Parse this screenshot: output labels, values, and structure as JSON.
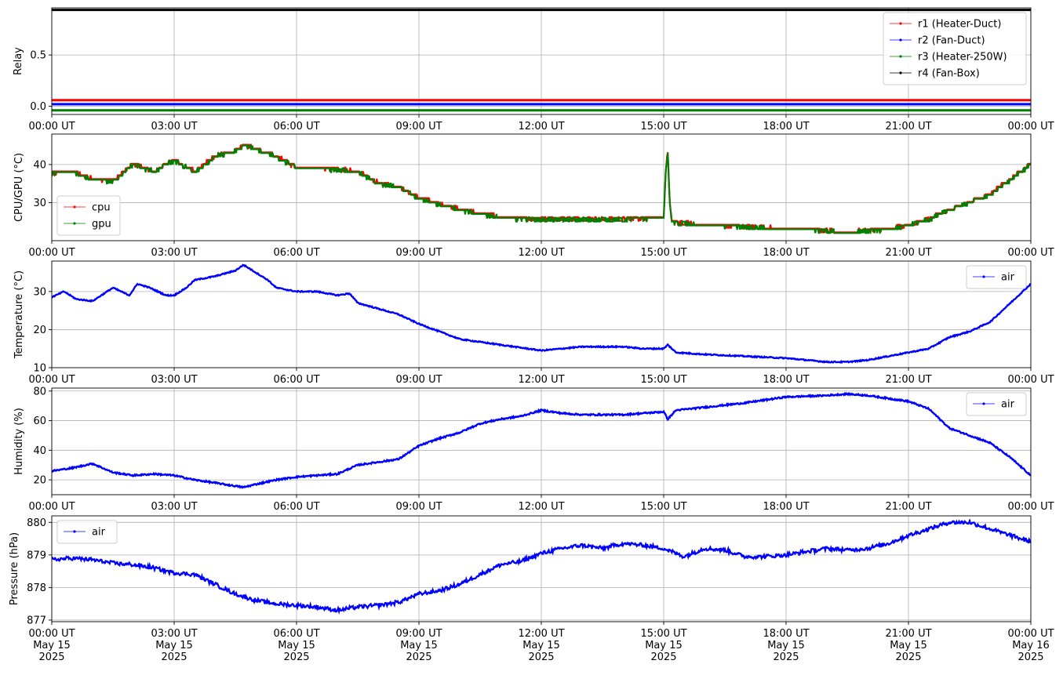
{
  "chart_data": [
    {
      "type": "line",
      "ylabel": "Relay",
      "ylim": [
        -0.08,
        0.96
      ],
      "yticks": [
        0.0,
        0.5
      ],
      "ytick_labels": [
        "0.0",
        "0.5"
      ],
      "grid": true,
      "legend": "top-right",
      "x_tick_labels": [
        "00:00 UT",
        "03:00 UT",
        "06:00 UT",
        "09:00 UT",
        "12:00 UT",
        "15:00 UT",
        "18:00 UT",
        "21:00 UT",
        "00:00 UT"
      ],
      "series": [
        {
          "name": "r1 (Heater-Duct)",
          "color": "#ff0000",
          "style": "constant",
          "value": 0.06
        },
        {
          "name": "r2 (Fan-Duct)",
          "color": "#0000ff",
          "style": "constant",
          "value": 0.02
        },
        {
          "name": "r3 (Heater-250W)",
          "color": "#008000",
          "style": "constant",
          "value": -0.04
        },
        {
          "name": "r4 (Fan-Box)",
          "color": "#000000",
          "style": "constant",
          "value": 0.94
        }
      ]
    },
    {
      "type": "scatter",
      "ylabel": "CPU/GPU (°C)",
      "ylim": [
        20,
        48
      ],
      "yticks": [
        30,
        40
      ],
      "ytick_labels": [
        "30",
        "40"
      ],
      "grid": true,
      "legend": "center-left",
      "x_tick_labels": [
        "00:00 UT",
        "03:00 UT",
        "06:00 UT",
        "09:00 UT",
        "12:00 UT",
        "15:00 UT",
        "18:00 UT",
        "21:00 UT",
        "00:00 UT"
      ],
      "series": [
        {
          "name": "cpu",
          "color": "#ff0000"
        },
        {
          "name": "gpu",
          "color": "#008000"
        }
      ],
      "x_hours": [
        0,
        0.5,
        1.0,
        1.5,
        2.0,
        2.5,
        3.0,
        3.5,
        4.0,
        4.5,
        4.7,
        5.0,
        5.5,
        6.0,
        6.5,
        7.0,
        7.5,
        8.0,
        8.5,
        9.0,
        9.5,
        10.0,
        10.5,
        11.0,
        12.0,
        13.0,
        14.0,
        15.0,
        15.05,
        15.1,
        15.15,
        15.2,
        15.3,
        16.0,
        17.0,
        18.0,
        18.5,
        19.0,
        19.5,
        20.0,
        20.5,
        21.0,
        21.5,
        22.0,
        22.5,
        23.0,
        23.5,
        24.0
      ],
      "y_values": [
        37.5,
        38,
        36,
        35.5,
        40,
        38,
        41,
        38,
        42,
        43.5,
        45,
        44,
        42,
        39,
        39,
        38.5,
        38,
        35,
        34,
        31,
        29.5,
        28,
        27,
        26,
        25.5,
        25.5,
        25.5,
        26,
        38,
        43,
        30,
        25,
        24.5,
        24,
        23.5,
        23,
        23,
        22.5,
        22,
        22.5,
        23,
        24,
        25.5,
        28,
        30,
        32,
        36,
        40
      ]
    },
    {
      "type": "scatter",
      "ylabel": "Temperature (°C)",
      "ylim": [
        10,
        38
      ],
      "yticks": [
        10,
        20,
        30
      ],
      "ytick_labels": [
        "10",
        "20",
        "30"
      ],
      "grid": true,
      "legend": "top-right",
      "x_tick_labels": [
        "00:00 UT",
        "03:00 UT",
        "06:00 UT",
        "09:00 UT",
        "12:00 UT",
        "15:00 UT",
        "18:00 UT",
        "21:00 UT",
        "00:00 UT"
      ],
      "series": [
        {
          "name": "air",
          "color": "#0000ff"
        }
      ],
      "x_hours": [
        0,
        0.3,
        0.6,
        1.0,
        1.5,
        1.9,
        2.1,
        2.4,
        2.8,
        3.0,
        3.3,
        3.5,
        4.0,
        4.5,
        4.7,
        5.0,
        5.3,
        5.5,
        6.0,
        6.5,
        7.0,
        7.3,
        7.5,
        8.0,
        8.5,
        9.0,
        9.5,
        10.0,
        11.0,
        12.0,
        13.0,
        14.0,
        14.5,
        15.0,
        15.1,
        15.3,
        16.0,
        17.0,
        18.0,
        19.0,
        19.5,
        20.0,
        20.5,
        21.0,
        21.5,
        22.0,
        22.5,
        23.0,
        23.5,
        24.0
      ],
      "y_values": [
        28.5,
        30,
        28,
        27.5,
        31,
        29,
        32,
        31,
        29,
        29,
        31,
        33,
        34,
        35.5,
        37,
        35,
        33,
        31,
        30,
        30,
        29,
        29.5,
        27,
        25.5,
        24,
        21.5,
        19.5,
        17.5,
        16,
        14.5,
        15.5,
        15.5,
        15,
        15,
        16,
        14,
        13.5,
        13,
        12.5,
        11.5,
        11.5,
        12,
        13,
        14,
        15,
        18,
        19.5,
        22,
        27,
        32
      ]
    },
    {
      "type": "scatter",
      "ylabel": "Humidity (%)",
      "ylim": [
        10,
        82
      ],
      "yticks": [
        20,
        40,
        60,
        80
      ],
      "ytick_labels": [
        "20",
        "40",
        "60",
        "80"
      ],
      "grid": true,
      "legend": "top-right",
      "x_tick_labels": [
        "00:00 UT",
        "03:00 UT",
        "06:00 UT",
        "09:00 UT",
        "12:00 UT",
        "15:00 UT",
        "18:00 UT",
        "21:00 UT",
        "00:00 UT"
      ],
      "series": [
        {
          "name": "air",
          "color": "#0000ff"
        }
      ],
      "x_hours": [
        0,
        0.5,
        1.0,
        1.5,
        2.0,
        2.5,
        3.0,
        3.5,
        4.0,
        4.7,
        5.0,
        5.5,
        6.0,
        6.5,
        7.0,
        7.5,
        8.0,
        8.5,
        9.0,
        9.5,
        10.0,
        10.5,
        11.0,
        11.5,
        12.0,
        12.5,
        13.0,
        14.0,
        15.0,
        15.1,
        15.3,
        16.0,
        17.0,
        18.0,
        18.5,
        19.0,
        19.5,
        20.0,
        20.5,
        21.0,
        21.5,
        22.0,
        22.5,
        23.0,
        23.5,
        24.0
      ],
      "y_values": [
        26,
        28,
        31,
        25,
        23,
        24,
        23,
        20,
        18,
        15,
        17,
        20,
        22,
        23,
        24,
        30,
        32,
        34,
        43,
        48,
        52,
        58,
        61,
        63,
        67,
        65,
        64,
        64,
        66,
        61,
        67,
        69,
        72,
        76,
        76.5,
        77,
        78,
        77,
        75,
        73,
        68,
        55,
        50,
        45,
        35,
        23
      ]
    },
    {
      "type": "scatter",
      "ylabel": "Pressure (hPa)",
      "ylim": [
        876.95,
        880.2
      ],
      "yticks": [
        877,
        878,
        879,
        880
      ],
      "ytick_labels": [
        "877",
        "878",
        "879",
        "880"
      ],
      "grid": true,
      "legend": "top-left",
      "x_tick_labels": [
        "00:00 UT\nMay 15\n2025",
        "03:00 UT\nMay 15\n2025",
        "06:00 UT\nMay 15\n2025",
        "09:00 UT\nMay 15\n2025",
        "12:00 UT\nMay 15\n2025",
        "15:00 UT\nMay 15\n2025",
        "18:00 UT\nMay 15\n2025",
        "21:00 UT\nMay 15\n2025",
        "00:00 UT\nMay 16\n2025"
      ],
      "series": [
        {
          "name": "air",
          "color": "#0000ff"
        }
      ],
      "x_hours": [
        0,
        0.5,
        1.0,
        1.5,
        2.0,
        2.5,
        3.0,
        3.5,
        4.0,
        4.5,
        5.0,
        5.5,
        6.0,
        6.5,
        7.0,
        7.5,
        8.0,
        8.5,
        9.0,
        9.5,
        10.0,
        10.5,
        11.0,
        11.5,
        12.0,
        12.5,
        13.0,
        13.5,
        14.0,
        14.5,
        15.0,
        15.5,
        16.0,
        16.5,
        17.0,
        17.5,
        18.0,
        18.5,
        19.0,
        19.5,
        20.0,
        20.5,
        21.0,
        21.5,
        22.0,
        22.5,
        23.0,
        23.5,
        24.0
      ],
      "y_values": [
        878.85,
        878.9,
        878.85,
        878.75,
        878.7,
        878.6,
        878.45,
        878.4,
        878.1,
        877.8,
        877.6,
        877.5,
        877.45,
        877.4,
        877.3,
        877.4,
        877.45,
        877.55,
        877.8,
        877.9,
        878.1,
        878.4,
        878.7,
        878.8,
        879.05,
        879.2,
        879.3,
        879.2,
        879.35,
        879.3,
        879.2,
        878.95,
        879.2,
        879.15,
        878.95,
        878.95,
        879.0,
        879.1,
        879.2,
        879.15,
        879.2,
        879.35,
        879.6,
        879.8,
        880.0,
        880.0,
        879.8,
        879.6,
        879.4
      ]
    }
  ]
}
